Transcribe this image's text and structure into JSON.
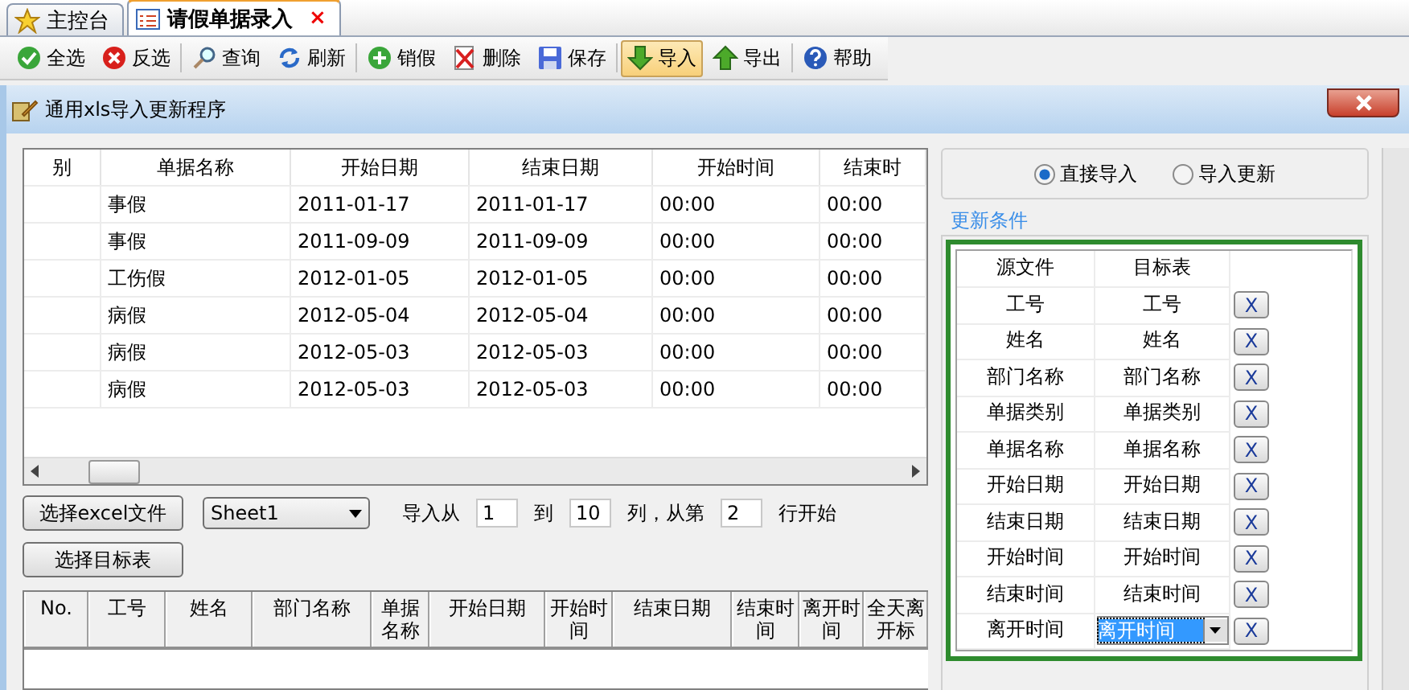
{
  "tabs": [
    {
      "label": "主控台",
      "selected": false,
      "kind": "star"
    },
    {
      "label": "请假单据录入",
      "selected": true,
      "kind": "list",
      "close": "×"
    }
  ],
  "toolbar": [
    {
      "label": "全选",
      "kind": "check",
      "selected": false
    },
    {
      "label": "反选",
      "kind": "cross",
      "selected": false
    },
    {
      "label": "查询",
      "kind": "search",
      "selected": false
    },
    {
      "label": "刷新",
      "kind": "refresh",
      "selected": false
    },
    {
      "label": "销假",
      "kind": "plus",
      "selected": false
    },
    {
      "label": "删除",
      "kind": "delete",
      "selected": false
    },
    {
      "label": "保存",
      "kind": "save",
      "selected": false
    },
    {
      "label": "导入",
      "kind": "down",
      "selected": true
    },
    {
      "label": "导出",
      "kind": "up",
      "selected": false
    },
    {
      "label": "帮助",
      "kind": "help",
      "selected": false
    }
  ],
  "dialog": {
    "title": "通用xls导入更新程序"
  },
  "source_grid": {
    "columns": [
      "别",
      "单据名称",
      "开始日期",
      "结束日期",
      "开始时间",
      "结束时"
    ],
    "rows": [
      [
        "",
        "事假",
        "2011-01-17",
        "2011-01-17",
        "00:00",
        "00:00"
      ],
      [
        "",
        "事假",
        "2011-09-09",
        "2011-09-09",
        "00:00",
        "00:00"
      ],
      [
        "",
        "工伤假",
        "2012-01-05",
        "2012-01-05",
        "00:00",
        "00:00"
      ],
      [
        "",
        "病假",
        "2012-05-04",
        "2012-05-04",
        "00:00",
        "00:00"
      ],
      [
        "",
        "病假",
        "2012-05-03",
        "2012-05-03",
        "00:00",
        "00:00"
      ],
      [
        "",
        "病假",
        "2012-05-03",
        "2012-05-03",
        "00:00",
        "00:00"
      ]
    ]
  },
  "file_button": "选择excel文件",
  "sheet": "Sheet1",
  "range": {
    "from_label": "导入从",
    "from": "1",
    "to_label": "到",
    "to": "10",
    "row_label": "列，从第",
    "row": "2",
    "row_suffix": "行开始"
  },
  "target_button": "选择目标表",
  "target_grid": {
    "columns": [
      "No.",
      "工号",
      "姓名",
      "部门名称",
      "单据名称",
      "开始日期",
      "开始时间",
      "结束日期",
      "结束时间",
      "离开时间",
      "全天离开标"
    ]
  },
  "mode": [
    {
      "label": "直接导入",
      "selected": true
    },
    {
      "label": "导入更新",
      "selected": false
    }
  ],
  "conditions": {
    "legend": "更新条件",
    "columns": [
      "源文件",
      "目标表"
    ],
    "rows": [
      {
        "source": "工号",
        "target": "工号",
        "kind": "text",
        "remove": "X"
      },
      {
        "source": "姓名",
        "target": "姓名",
        "kind": "text",
        "remove": "X"
      },
      {
        "source": "部门名称",
        "target": "部门名称",
        "kind": "text",
        "remove": "X"
      },
      {
        "source": "单据类别",
        "target": "单据类别",
        "kind": "text",
        "remove": "X"
      },
      {
        "source": "单据名称",
        "target": "单据名称",
        "kind": "text",
        "remove": "X"
      },
      {
        "source": "开始日期",
        "target": "开始日期",
        "kind": "text",
        "remove": "X"
      },
      {
        "source": "结束日期",
        "target": "结束日期",
        "kind": "text",
        "remove": "X"
      },
      {
        "source": "开始时间",
        "target": "开始时间",
        "kind": "text",
        "remove": "X"
      },
      {
        "source": "结束时间",
        "target": "结束时间",
        "kind": "text",
        "remove": "X"
      },
      {
        "source": "离开时间",
        "target": "离开时间",
        "kind": "select",
        "remove": "X"
      }
    ]
  }
}
